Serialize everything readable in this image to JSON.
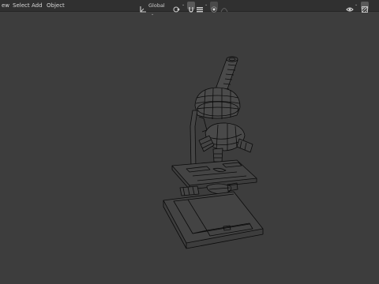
{
  "header": {
    "menu": {
      "view": "ew",
      "select": "Select",
      "add": "Add",
      "object": "Object"
    },
    "transform_orientation": "Global",
    "icons": {
      "orientation": "orientation-axes-icon",
      "pivot": "pivot-point-icon",
      "snap": "snap-magnet-icon",
      "snap_target": "snap-increment-icon",
      "proportional": "proportional-editing-icon",
      "proportional_falloff": "falloff-curve-icon",
      "visibility": "object-visibility-icon",
      "xray": "xray-toggle-icon"
    }
  },
  "viewport": {
    "background": "#3d3d3d",
    "wire_color": "#0a0a0a",
    "object": "microscope wireframe"
  }
}
